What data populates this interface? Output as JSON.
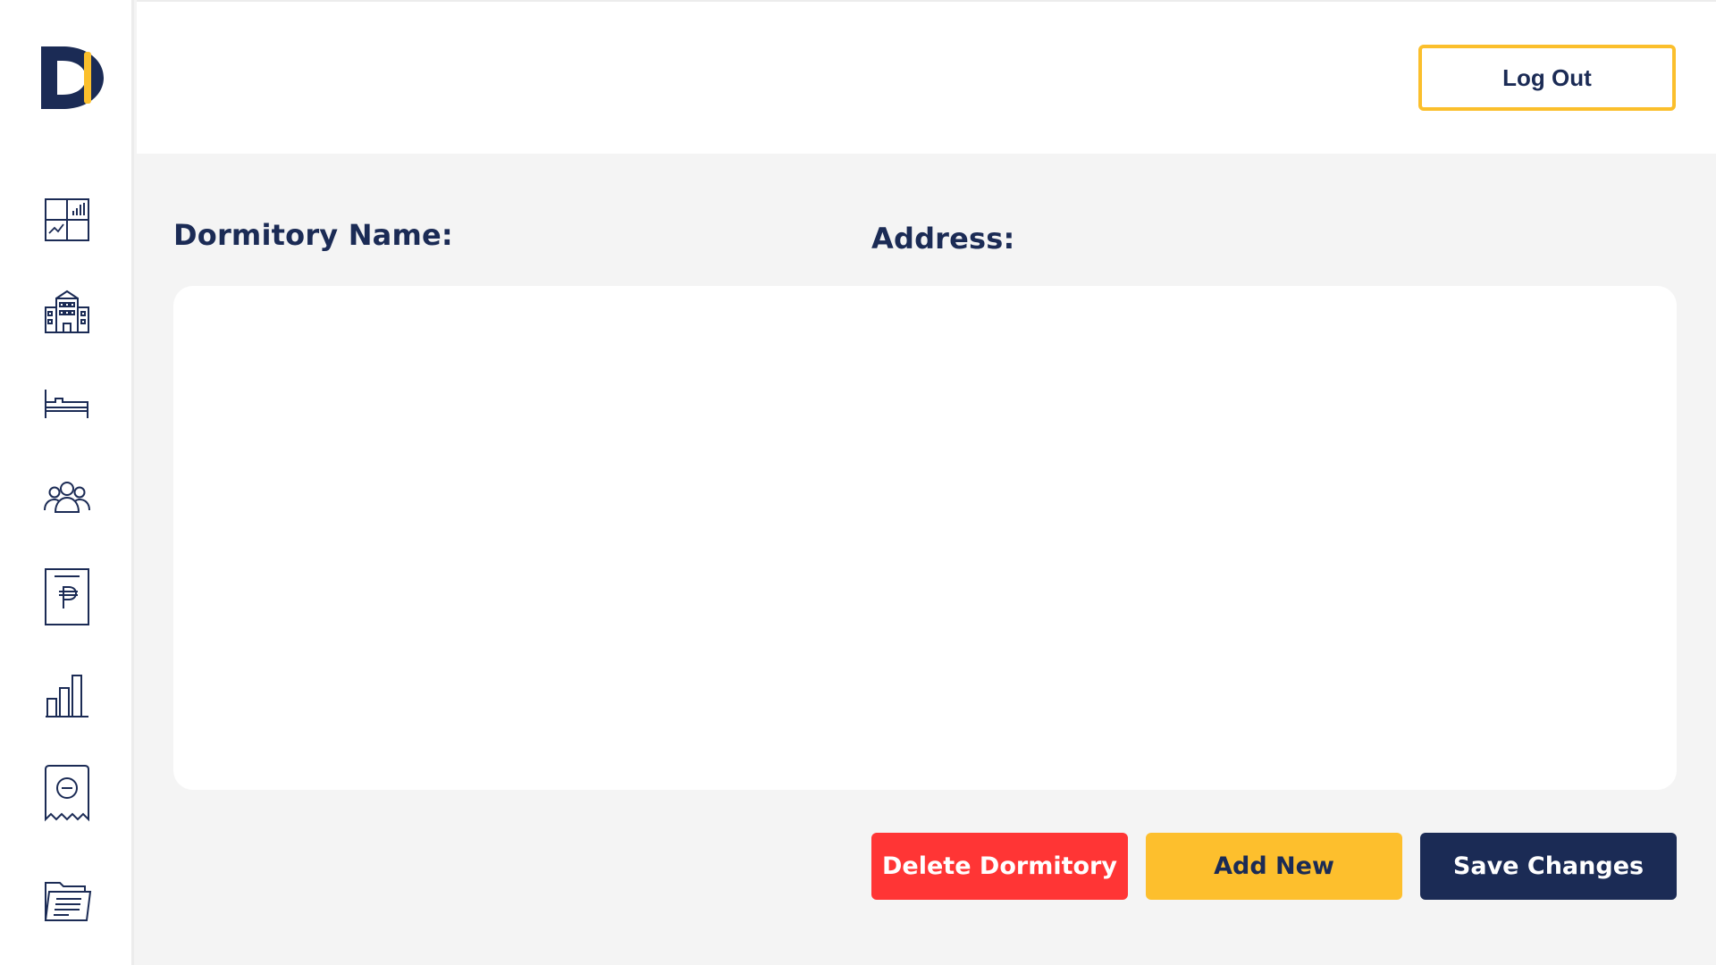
{
  "header": {
    "logout_label": "Log Out"
  },
  "sidebar": {
    "logo_icon": "dormitory-logo",
    "items": [
      {
        "icon": "dashboard-icon"
      },
      {
        "icon": "building-icon"
      },
      {
        "icon": "bed-icon"
      },
      {
        "icon": "people-icon"
      },
      {
        "icon": "peso-document-icon"
      },
      {
        "icon": "bar-chart-icon"
      },
      {
        "icon": "expense-receipt-icon"
      },
      {
        "icon": "folder-icon"
      }
    ]
  },
  "main": {
    "dormitory_name_label": "Dormitory Name:",
    "address_label": "Address:"
  },
  "actions": {
    "delete_label": "Delete Dormitory",
    "add_label": "Add New",
    "save_label": "Save Changes"
  },
  "colors": {
    "navy": "#1b2b55",
    "accent_yellow": "#fbbf2c",
    "danger_red": "#ff3535",
    "background": "#f4f4f4"
  }
}
